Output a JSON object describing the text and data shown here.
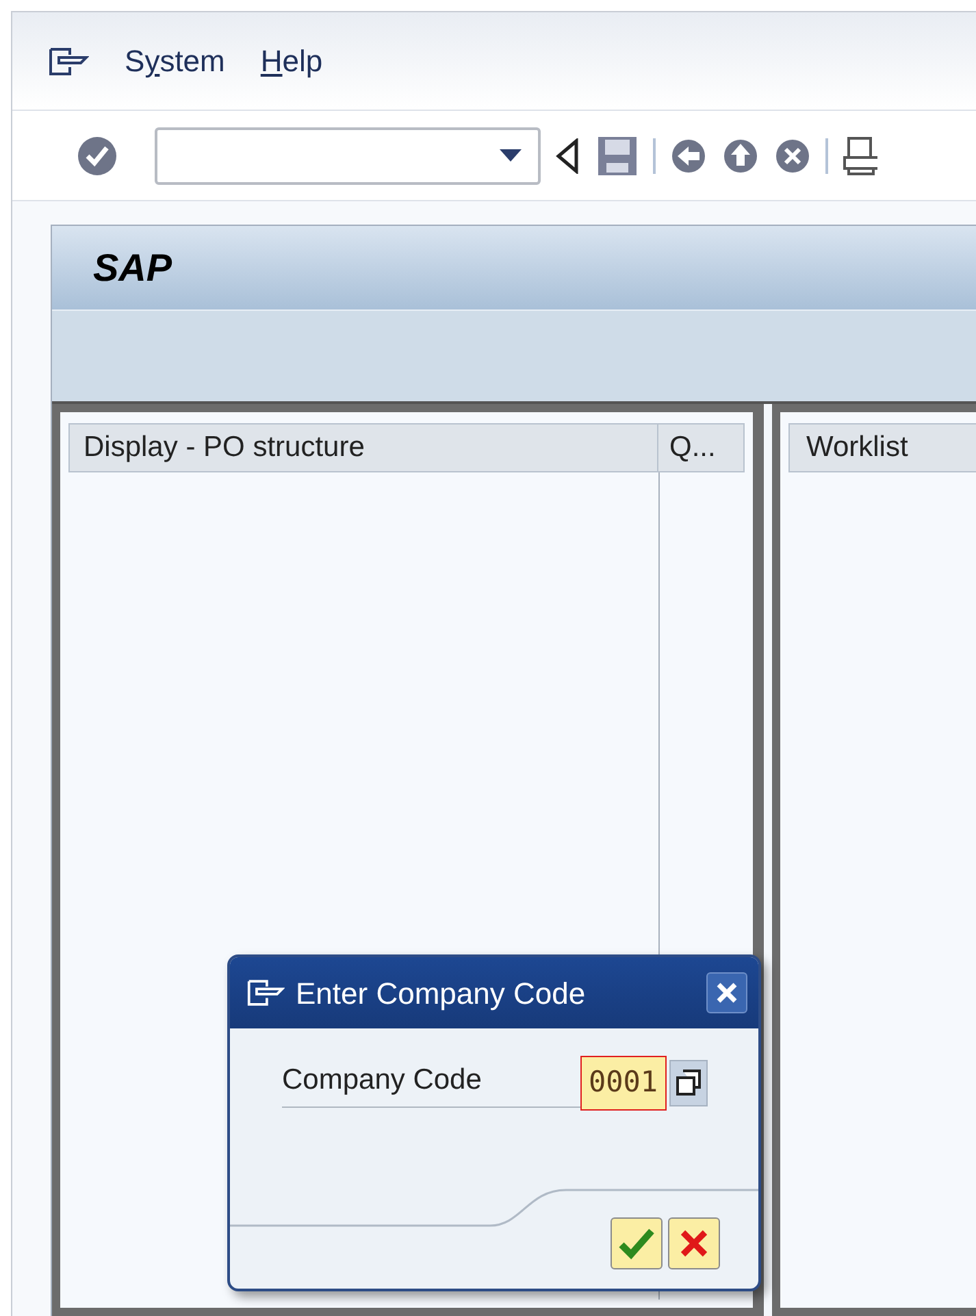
{
  "menu": [
    {
      "before": "S",
      "access_key": "y",
      "after": "stem"
    },
    {
      "access_key": "H",
      "after": "elp"
    }
  ],
  "title": "SAP",
  "left_panel": {
    "columns": [
      "Display - PO structure",
      "Q..."
    ]
  },
  "right_panel": {
    "columns": [
      "Worklist"
    ]
  },
  "dialog": {
    "title": "Enter Company Code",
    "field": {
      "label": "Company Code",
      "value": "0001",
      "focused": true
    }
  }
}
